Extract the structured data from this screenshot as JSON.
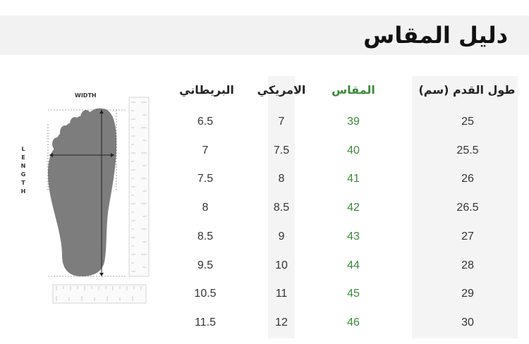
{
  "title": "دليل المقاس",
  "illustration": {
    "width_label": "WIDTH",
    "length_letters": [
      "L",
      "E",
      "N",
      "G",
      "T",
      "H"
    ]
  },
  "table": {
    "headers": {
      "uk": "البريطاني",
      "us": "الامريكي",
      "size": "المقاس",
      "foot_length": "طول القدم (سم)"
    },
    "rows": [
      {
        "uk": "6.5",
        "us": "7",
        "size": "39",
        "cm": "25"
      },
      {
        "uk": "7",
        "us": "7.5",
        "size": "40",
        "cm": "25.5"
      },
      {
        "uk": "7.5",
        "us": "8",
        "size": "41",
        "cm": "26"
      },
      {
        "uk": "8",
        "us": "8.5",
        "size": "42",
        "cm": "26.5"
      },
      {
        "uk": "8.5",
        "us": "9",
        "size": "43",
        "cm": "27"
      },
      {
        "uk": "9.5",
        "us": "10",
        "size": "44",
        "cm": "28"
      },
      {
        "uk": "10.5",
        "us": "11",
        "size": "45",
        "cm": "29"
      },
      {
        "uk": "11.5",
        "us": "12",
        "size": "46",
        "cm": "30"
      }
    ]
  },
  "colors": {
    "accent": "#3a8a3a",
    "band": "#f2f2f2",
    "column_shade": "#f4f4f4"
  }
}
